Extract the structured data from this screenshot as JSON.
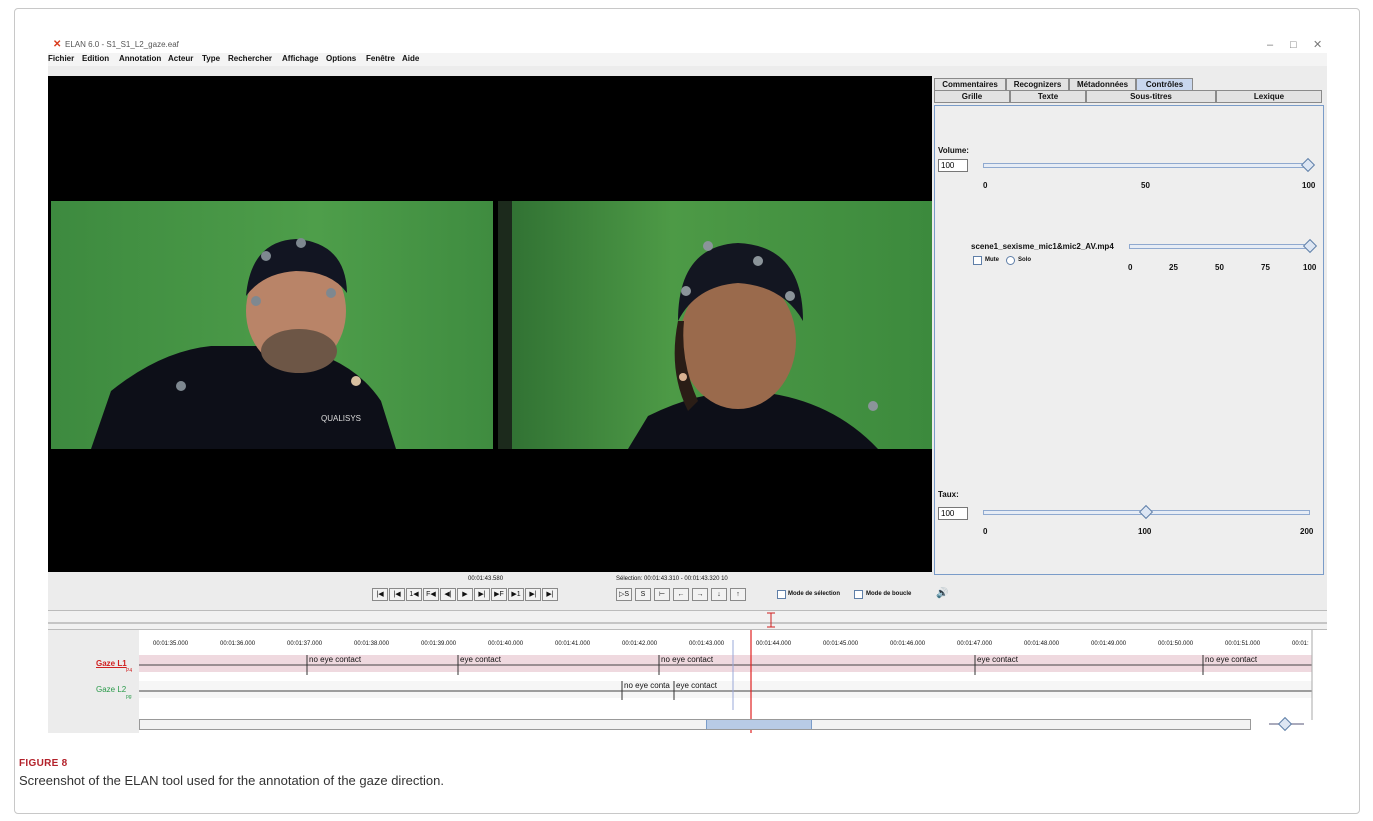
{
  "window": {
    "title": "ELAN 6.0 - S1_S1_L2_gaze.eaf",
    "controls": {
      "minimize": "–",
      "maximize": "□",
      "close": "✕"
    }
  },
  "menu": [
    "Fichier",
    "Edition",
    "Annotation",
    "Acteur",
    "Type",
    "Rechercher",
    "Affichage",
    "Options",
    "Fenêtre",
    "Aide"
  ],
  "side_tabs": {
    "row1": [
      "Commentaires",
      "Recognizers",
      "Métadonnées",
      "Contrôles"
    ],
    "row2": [
      "Grille",
      "Texte",
      "Sous-titres",
      "Lexique"
    ],
    "active": "Contrôles"
  },
  "controls_panel": {
    "volume": {
      "label": "Volume:",
      "value": "100",
      "ticks": [
        "0",
        "50",
        "100"
      ],
      "level": 1.0
    },
    "media": {
      "file": "scene1_sexisme_mic1&mic2_AV.mp4",
      "mute": "Mute",
      "solo": "Solo",
      "ticks": [
        "0",
        "25",
        "50",
        "75",
        "100"
      ],
      "level": 1.0
    },
    "rate": {
      "label": "Taux:",
      "value": "100",
      "ticks": [
        "0",
        "100",
        "200"
      ],
      "level": 0.5
    }
  },
  "transport": {
    "current_time": "00:01:43.580",
    "selection": "Sélection: 00:01:43.310 - 00:01:43.320  10",
    "selection_mode": "Mode de sélection",
    "loop_mode": "Mode de boucle",
    "buttons": [
      "|◀",
      "|◀",
      "1◀",
      "F◀",
      "◀|",
      "▶",
      "▶|",
      "▶F",
      "▶1",
      "▶|",
      "▶|"
    ],
    "sel_buttons": [
      "▷S",
      "S",
      "⊢",
      "←",
      "→",
      "↓",
      "↑"
    ]
  },
  "timeline": {
    "time_labels": [
      "00:01:35.000",
      "00:01:36.000",
      "00:01:37.000",
      "00:01:38.000",
      "00:01:39.000",
      "00:01:40.000",
      "00:01:41.000",
      "00:01:42.000",
      "00:01:43.000",
      "00:01:44.000",
      "00:01:45.000",
      "00:01:46.000",
      "00:01:47.000",
      "00:01:48.000",
      "00:01:49.000",
      "00:01:50.000",
      "00:01:51.000",
      "00:01:"
    ],
    "tiers": [
      {
        "name": "Gaze L1",
        "sub": "P4",
        "color": "#d02020",
        "annotations": [
          "no eye contact",
          "eye contact",
          "no eye contact",
          "eye contact",
          "no eye contact"
        ]
      },
      {
        "name": "Gaze L2",
        "sub": "pg",
        "color": "#2a9a4a",
        "annotations": [
          "no eye conta",
          "eye contact"
        ]
      }
    ]
  },
  "video": {
    "overlay_text": "QUALISYS"
  },
  "caption": {
    "label": "FIGURE 8",
    "text": "Screenshot of the ELAN tool used for the annotation of the gaze direction."
  }
}
